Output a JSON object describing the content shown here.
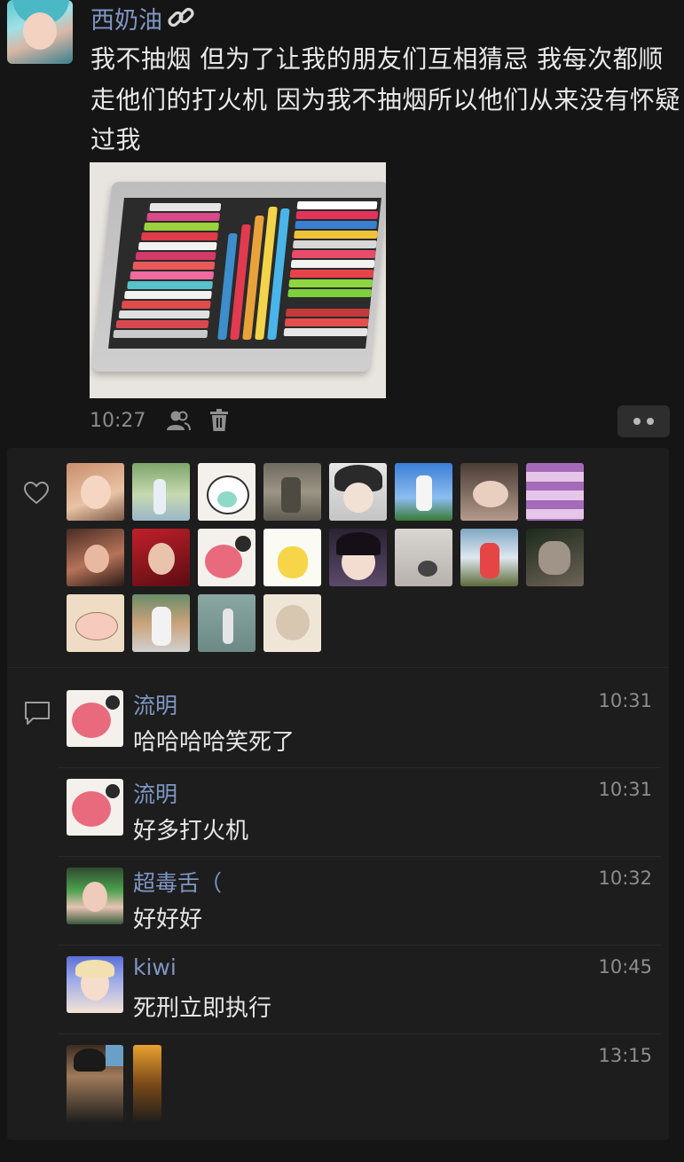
{
  "post": {
    "author": "西奶油",
    "text": "我不抽烟 但为了让我的朋友们互相猜忌 我每次都顺走他们的打火机 因为我不抽烟所以他们从来没有怀疑过我",
    "time": "10:27",
    "icons": [
      "link-icon",
      "people-icon",
      "trash-icon",
      "more-icon",
      "heart-icon",
      "comment-icon"
    ]
  },
  "likes": {
    "count_shown": 20
  },
  "comments": [
    {
      "name": "流明",
      "time": "10:31",
      "text": "哈哈哈哈笑死了"
    },
    {
      "name": "流明",
      "time": "10:31",
      "text": "好多打火机"
    },
    {
      "name": "超毒舌（",
      "time": "10:32",
      "text": "好好好"
    },
    {
      "name": "kiwi",
      "time": "10:45",
      "text": "死刑立即执行"
    },
    {
      "name": "",
      "time": "13:15",
      "text": ""
    }
  ]
}
